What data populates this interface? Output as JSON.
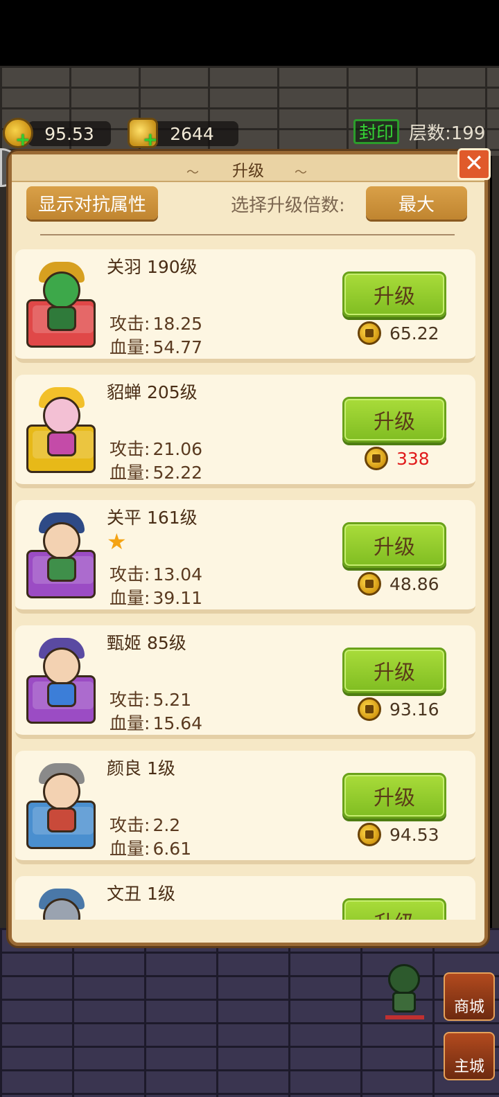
{
  "resources": {
    "coins": "95.53",
    "ingots": "2644",
    "seal_label": "封印",
    "floor_label": "层数:199"
  },
  "dialog": {
    "title": "升级",
    "show_counter_label": "显示对抗属性",
    "multiplier_label": "选择升级倍数:",
    "multiplier_value": "最大",
    "close_symbol": "✕"
  },
  "heroes": [
    {
      "name": "关羽 190级",
      "attack_label": "攻击:",
      "attack": "18.25",
      "hp_label": "血量:",
      "hp": "54.77",
      "button": "升级",
      "cost": "65.22",
      "affordable": true,
      "pedestal": "#e04848",
      "star": false
    },
    {
      "name": "貂蝉 205级",
      "attack_label": "攻击:",
      "attack": "21.06",
      "hp_label": "血量:",
      "hp": "52.22",
      "button": "升级",
      "cost": "338",
      "affordable": false,
      "pedestal": "#e7b918",
      "star": false
    },
    {
      "name": "关平 161级",
      "attack_label": "攻击:",
      "attack": "13.04",
      "hp_label": "血量:",
      "hp": "39.11",
      "button": "升级",
      "cost": "48.86",
      "affordable": true,
      "pedestal": "#9b4cc4",
      "star": true
    },
    {
      "name": "甄姬 85级",
      "attack_label": "攻击:",
      "attack": "5.21",
      "hp_label": "血量:",
      "hp": "15.64",
      "button": "升级",
      "cost": "93.16",
      "affordable": true,
      "pedestal": "#9b4cc4",
      "star": false
    },
    {
      "name": "颜良 1级",
      "attack_label": "攻击:",
      "attack": "2.2",
      "hp_label": "血量:",
      "hp": "6.61",
      "button": "升级",
      "cost": "94.53",
      "affordable": true,
      "pedestal": "#4a8fcf",
      "star": false
    },
    {
      "name": "文丑 1级",
      "button": "升级"
    }
  ],
  "side_buttons": {
    "shop": "商城",
    "main_city": "主城"
  },
  "colors": {
    "dialog_bg": "#f6e8c6",
    "upgrade_button": "#8fca2a",
    "unaffordable_cost": "#e01a1a",
    "seal_green": "#35d435"
  }
}
